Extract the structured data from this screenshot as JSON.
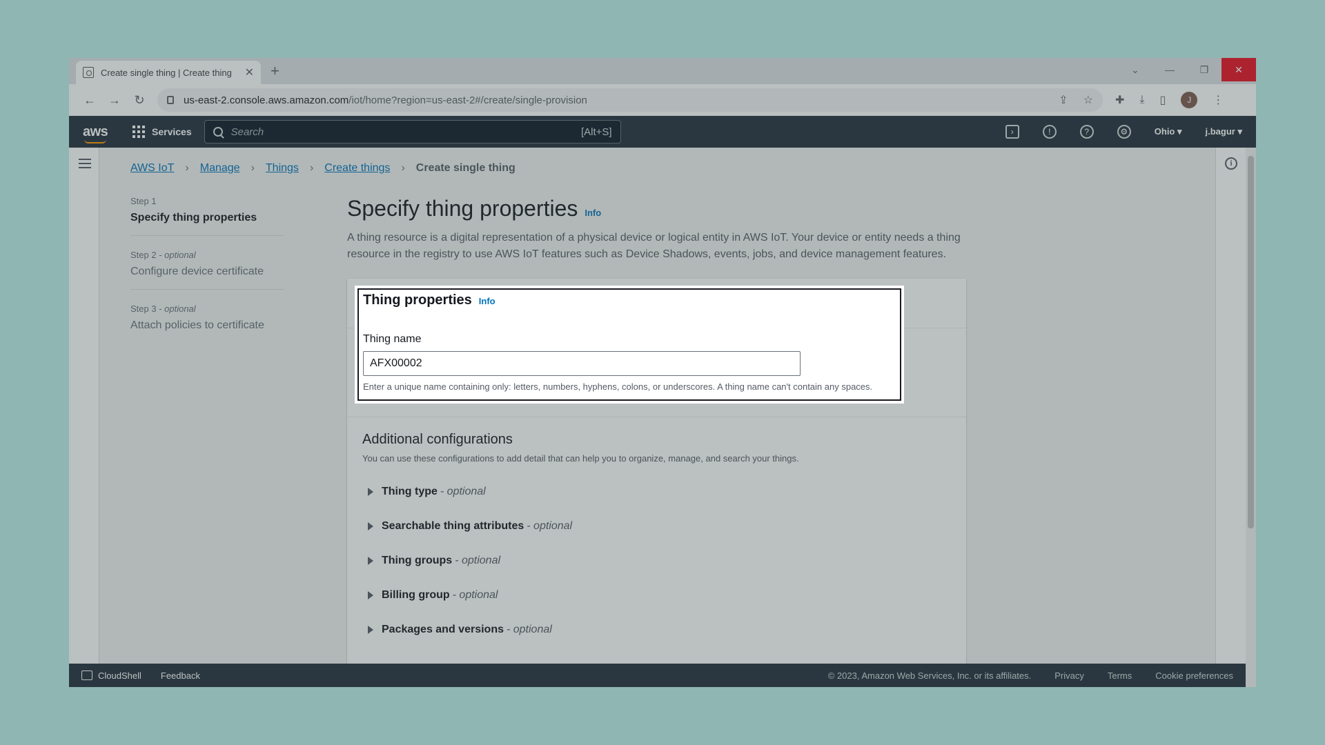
{
  "browser": {
    "tab_title": "Create single thing | Create thing",
    "tab_close": "✕",
    "new_tab": "+",
    "url_host": "us-east-2.console.aws.amazon.com",
    "url_path": "/iot/home?region=us-east-2#/create/single-provision",
    "profile_initial": "J"
  },
  "awsnav": {
    "logo": "aws",
    "services": "Services",
    "search_placeholder": "Search",
    "search_shortcut": "[Alt+S]",
    "region": "Ohio ▾",
    "user": "j.bagur ▾"
  },
  "breadcrumb": {
    "items": [
      "AWS IoT",
      "Manage",
      "Things",
      "Create things"
    ],
    "current": "Create single thing"
  },
  "steps": [
    {
      "num": "Step 1",
      "optional": "",
      "title": "Specify thing properties"
    },
    {
      "num": "Step 2 - ",
      "optional": "optional",
      "title": "Configure device certificate"
    },
    {
      "num": "Step 3 - ",
      "optional": "optional",
      "title": "Attach policies to certificate"
    }
  ],
  "main": {
    "title": "Specify thing properties",
    "info": "Info",
    "description": "A thing resource is a digital representation of a physical device or logical entity in AWS IoT. Your device or entity needs a thing resource in the registry to use AWS IoT features such as Device Shadows, events, jobs, and device management features."
  },
  "thing_properties": {
    "title": "Thing properties",
    "info": "Info",
    "field_label": "Thing name",
    "field_value": "AFX00002",
    "hint": "Enter a unique name containing only: letters, numbers, hyphens, colons, or underscores. A thing name can't contain any spaces."
  },
  "additional": {
    "title": "Additional configurations",
    "description": "You can use these configurations to add detail that can help you to organize, manage, and search your things.",
    "sections": [
      {
        "label": "Thing type",
        "optional": "- optional"
      },
      {
        "label": "Searchable thing attributes",
        "optional": "- optional"
      },
      {
        "label": "Thing groups",
        "optional": "- optional"
      },
      {
        "label": "Billing group",
        "optional": "- optional"
      },
      {
        "label": "Packages and versions",
        "optional": "- optional"
      }
    ]
  },
  "footer": {
    "cloudshell": "CloudShell",
    "feedback": "Feedback",
    "copyright": "© 2023, Amazon Web Services, Inc. or its affiliates.",
    "privacy": "Privacy",
    "terms": "Terms",
    "cookies": "Cookie preferences"
  }
}
